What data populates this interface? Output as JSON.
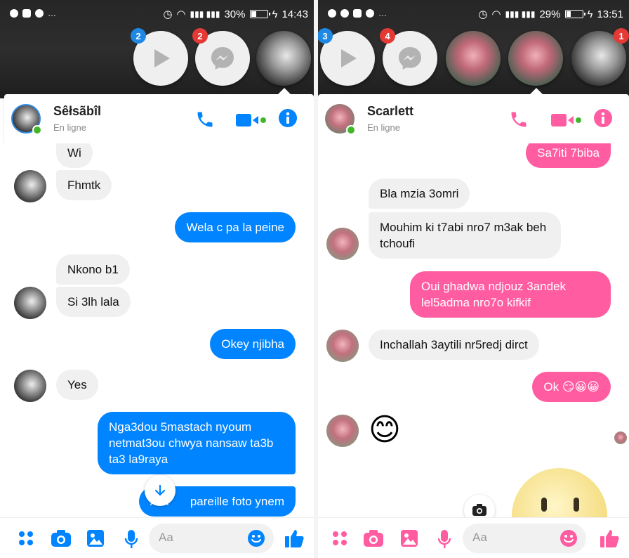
{
  "left": {
    "status": {
      "time": "14:43",
      "battery": "30%",
      "battery_level": 0.3
    },
    "chat_heads": [
      {
        "badge": "2",
        "badge_color": "#1e88e5",
        "kind": "play"
      },
      {
        "badge": "2",
        "badge_color": "#e53935",
        "kind": "messenger"
      },
      {
        "kind": "photo"
      }
    ],
    "contact": {
      "name": "Sêłsãbîl",
      "status": "En ligne"
    },
    "accent": "#0084ff",
    "messages": [
      {
        "dir": "in",
        "text": "Wi"
      },
      {
        "dir": "in",
        "text": "Fhmtk"
      },
      {
        "dir": "out",
        "text": "Wela c pa la peine"
      },
      {
        "dir": "in",
        "text": "Nkono b1"
      },
      {
        "dir": "in",
        "text": "Si 3lh lala"
      },
      {
        "dir": "out",
        "text": "Okey njibha"
      },
      {
        "dir": "in",
        "text": "Yes"
      },
      {
        "dir": "out",
        "text": "Nga3dou 5mastach nyoum netmat3ou chwya nansaw ta3b ta3 la9raya"
      },
      {
        "dir": "out",
        "text": "Awl"
      },
      {
        "dir": "out",
        "text": "pareille foto ynem"
      }
    ],
    "composer": {
      "placeholder": "Aa"
    }
  },
  "right": {
    "status": {
      "time": "13:51",
      "battery": "29%",
      "battery_level": 0.29
    },
    "chat_heads": [
      {
        "badge": "3",
        "badge_color": "#1e88e5",
        "kind": "play"
      },
      {
        "badge": "4",
        "badge_color": "#e53935",
        "kind": "messenger"
      },
      {
        "kind": "photo"
      },
      {
        "kind": "photo"
      },
      {
        "badge": "1",
        "badge_color": "#e53935",
        "kind": "photo"
      }
    ],
    "contact": {
      "name": "Scarlett",
      "status": "En ligne"
    },
    "accent": "#ff5ca1",
    "messages": [
      {
        "dir": "out",
        "text": "Sa7iti 7biba"
      },
      {
        "dir": "in",
        "text": "Bla mzia 3omri"
      },
      {
        "dir": "in",
        "text": "Mouhim ki t7abi nro7 m3ak beh tchoufi"
      },
      {
        "dir": "out",
        "text": "Oui ghadwa ndjouz 3andek lel5adma nro7o kifkif"
      },
      {
        "dir": "in",
        "text": "Inchallah 3aytili nr5redj dirct"
      },
      {
        "dir": "out",
        "text": "Ok 😏😀😀"
      },
      {
        "dir": "in",
        "text": "😊"
      }
    ],
    "composer": {
      "placeholder": "Aa"
    }
  }
}
